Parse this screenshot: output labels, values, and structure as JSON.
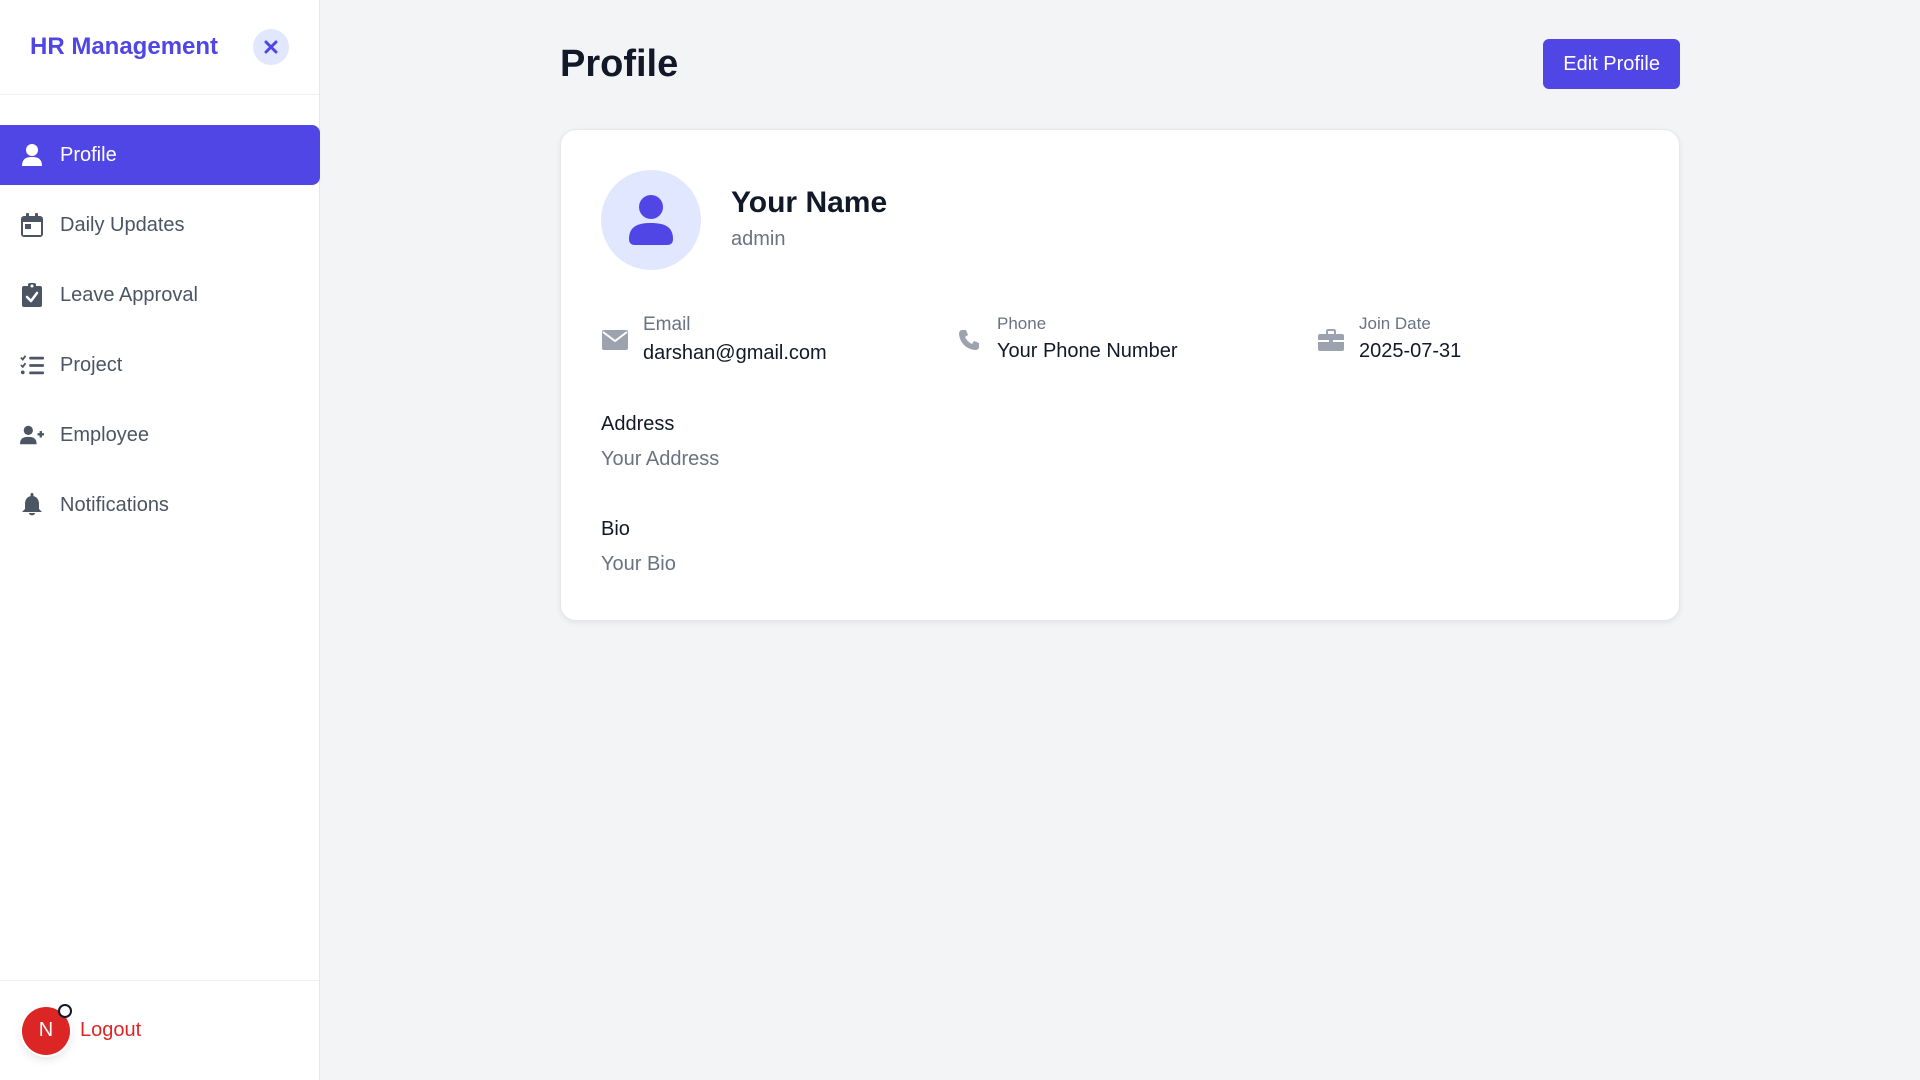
{
  "app": {
    "title": "HR Management"
  },
  "sidebar": {
    "items": [
      {
        "label": "Profile",
        "icon": "user-icon",
        "active": true
      },
      {
        "label": "Daily Updates",
        "icon": "calendar-icon"
      },
      {
        "label": "Leave Approval",
        "icon": "clipboard-check-icon"
      },
      {
        "label": "Project",
        "icon": "list-check-icon"
      },
      {
        "label": "Employee",
        "icon": "user-plus-icon"
      },
      {
        "label": "Notifications",
        "icon": "bell-icon"
      }
    ],
    "footer": {
      "avatar_letter": "N",
      "logout_label": "Logout"
    }
  },
  "page": {
    "title": "Profile",
    "edit_label": "Edit Profile"
  },
  "profile": {
    "name": "Your Name",
    "role": "admin",
    "email_label": "Email",
    "email": "darshan@gmail.com",
    "phone_label": "Phone",
    "phone": "Your Phone Number",
    "join_label": "Join Date",
    "join_date": "2025-07-31",
    "address_label": "Address",
    "address": "Your Address",
    "bio_label": "Bio",
    "bio": "Your Bio"
  },
  "colors": {
    "accent": "#4f46e5",
    "accent_light": "#e0e7ff",
    "danger": "#dc2626",
    "background": "#f3f4f6"
  }
}
